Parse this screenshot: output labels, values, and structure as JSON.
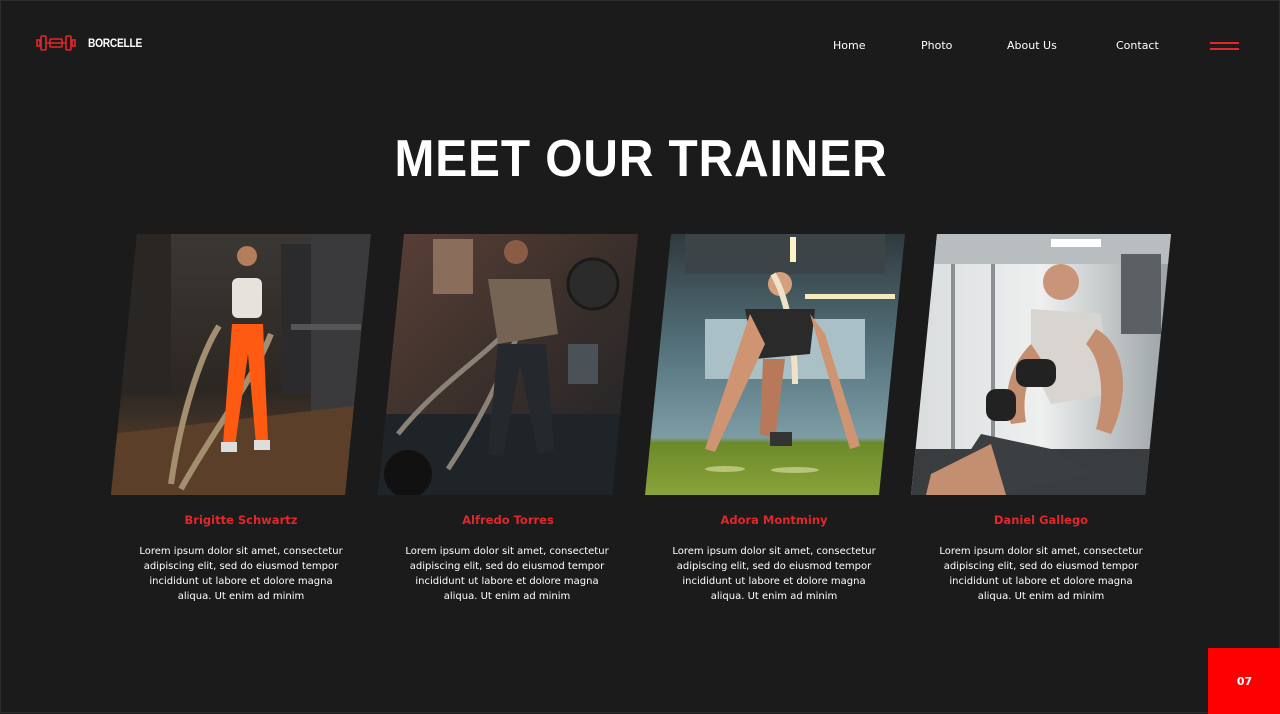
{
  "brand": {
    "name": "BORCELLE",
    "icon": "dumbbell-icon",
    "accent": "#e3262b"
  },
  "nav": {
    "items": [
      "Home",
      "Photo",
      "About Us",
      "Contact"
    ],
    "menu_icon": "hamburger-menu-icon"
  },
  "hero": {
    "title": "MEET OUR TRAINER"
  },
  "trainers": [
    {
      "name": "Brigitte Schwartz",
      "description": "Lorem ipsum dolor sit amet, consectetur adipiscing elit, sed do eiusmod tempor incididunt ut labore et dolore magna aliqua. Ut enim ad minim",
      "photo": "woman-battle-ropes-photo"
    },
    {
      "name": "Alfredo Torres",
      "description": "Lorem ipsum dolor sit amet, consectetur adipiscing elit, sed do eiusmod tempor incididunt ut labore et dolore magna aliqua. Ut enim ad minim",
      "photo": "man-battle-ropes-photo"
    },
    {
      "name": "Adora Montminy",
      "description": "Lorem ipsum dolor sit amet, consectetur adipiscing elit, sed do eiusmod tempor incididunt ut labore et dolore magna aliqua. Ut enim ad minim",
      "photo": "woman-sprint-start-photo"
    },
    {
      "name": "Daniel Gallego",
      "description": "Lorem ipsum dolor sit amet, consectetur adipiscing elit, sed do eiusmod tempor incididunt ut labore et dolore magna aliqua. Ut enim ad minim",
      "photo": "man-dumbbell-curl-photo"
    }
  ],
  "page": {
    "number": "07",
    "badge_color": "#ff0000"
  }
}
